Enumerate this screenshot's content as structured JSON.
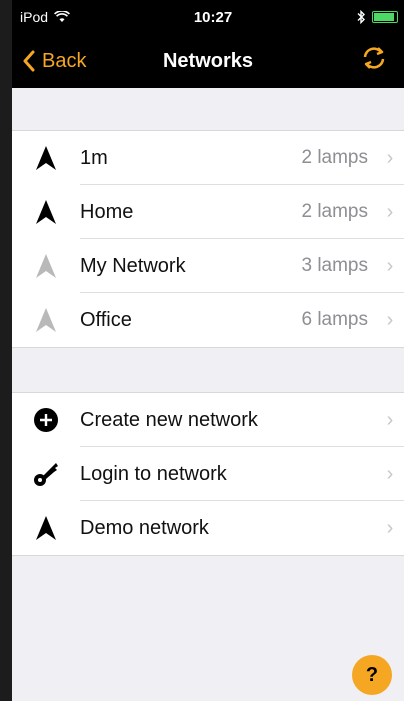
{
  "status": {
    "carrier": "iPod",
    "time": "10:27"
  },
  "nav": {
    "back_label": "Back",
    "title": "Networks"
  },
  "networks": [
    {
      "name": "1m",
      "lamps": "2 lamps",
      "icon": "network-icon-dark"
    },
    {
      "name": "Home",
      "lamps": "2 lamps",
      "icon": "network-icon-dark"
    },
    {
      "name": "My Network",
      "lamps": "3 lamps",
      "icon": "network-icon-grey"
    },
    {
      "name": "Office",
      "lamps": "6 lamps",
      "icon": "network-icon-grey"
    }
  ],
  "actions": [
    {
      "label": "Create new network",
      "icon": "plus-circle-icon"
    },
    {
      "label": "Login to network",
      "icon": "key-icon"
    },
    {
      "label": "Demo network",
      "icon": "network-icon-dark"
    }
  ],
  "help": {
    "label": "?"
  },
  "colors": {
    "accent": "#f5a623",
    "icon_dark": "#000000",
    "icon_grey": "#b9b9b9"
  }
}
